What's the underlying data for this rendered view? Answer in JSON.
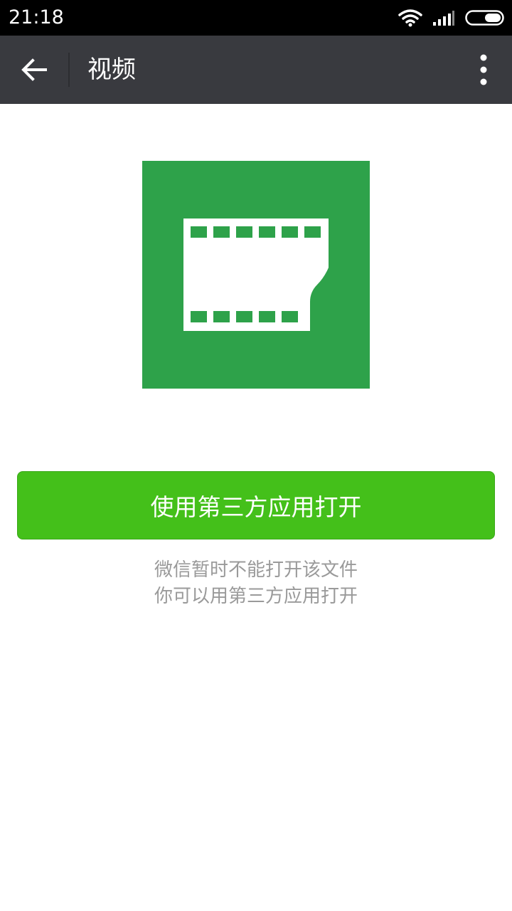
{
  "status_bar": {
    "time": "21:18",
    "icons": [
      "wifi-icon",
      "signal-icon",
      "battery-icon"
    ]
  },
  "app_bar": {
    "back_icon": "arrow-left-icon",
    "title": "视频",
    "more_icon": "more-vertical-icon"
  },
  "file_icon": {
    "name": "video-file-icon",
    "background": "#2ea24a"
  },
  "open_button": {
    "label": "使用第三方应用打开",
    "color": "#44c01a"
  },
  "hint": {
    "line1": "微信暂时不能打开该文件",
    "line2": "你可以用第三方应用打开"
  }
}
